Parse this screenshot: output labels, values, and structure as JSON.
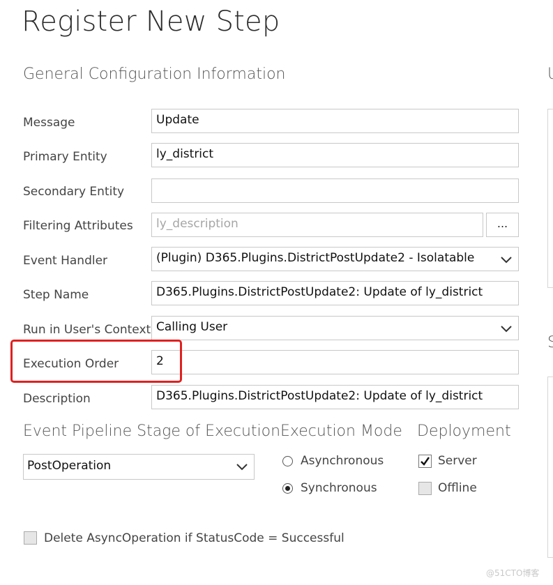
{
  "page_title": "Register New Step",
  "section_general": "General Configuration Information",
  "fields": {
    "message": {
      "label": "Message",
      "value": "Update"
    },
    "primary_entity": {
      "label": "Primary Entity",
      "value": "ly_district"
    },
    "secondary_entity": {
      "label": "Secondary Entity",
      "value": ""
    },
    "filtering_attributes": {
      "label": "Filtering Attributes",
      "placeholder": "ly_description",
      "button": "..."
    },
    "event_handler": {
      "label": "Event Handler",
      "value": "(Plugin) D365.Plugins.DistrictPostUpdate2 - Isolatable"
    },
    "step_name": {
      "label": "Step Name",
      "value": "D365.Plugins.DistrictPostUpdate2: Update of ly_district"
    },
    "run_context": {
      "label": "Run in User's Context",
      "value": "Calling User"
    },
    "execution_order": {
      "label": "Execution Order",
      "value": "2"
    },
    "description": {
      "label": "Description",
      "value": "D365.Plugins.DistrictPostUpdate2: Update of ly_district"
    }
  },
  "pipeline": {
    "heading": "Event Pipeline Stage of Execution",
    "value": "PostOperation"
  },
  "execution_mode": {
    "heading": "Execution Mode",
    "options": [
      {
        "label": "Asynchronous",
        "selected": false
      },
      {
        "label": "Synchronous",
        "selected": true
      }
    ]
  },
  "deployment": {
    "heading": "Deployment",
    "options": [
      {
        "label": "Server",
        "checked": true
      },
      {
        "label": "Offline",
        "checked": false
      }
    ]
  },
  "delete_async": {
    "label": "Delete AsyncOperation if StatusCode = Successful",
    "checked": false
  },
  "right_panel_headings": [
    "U",
    "S"
  ],
  "watermark": "@51CTO博客",
  "colors": {
    "highlight": "#e02020"
  }
}
